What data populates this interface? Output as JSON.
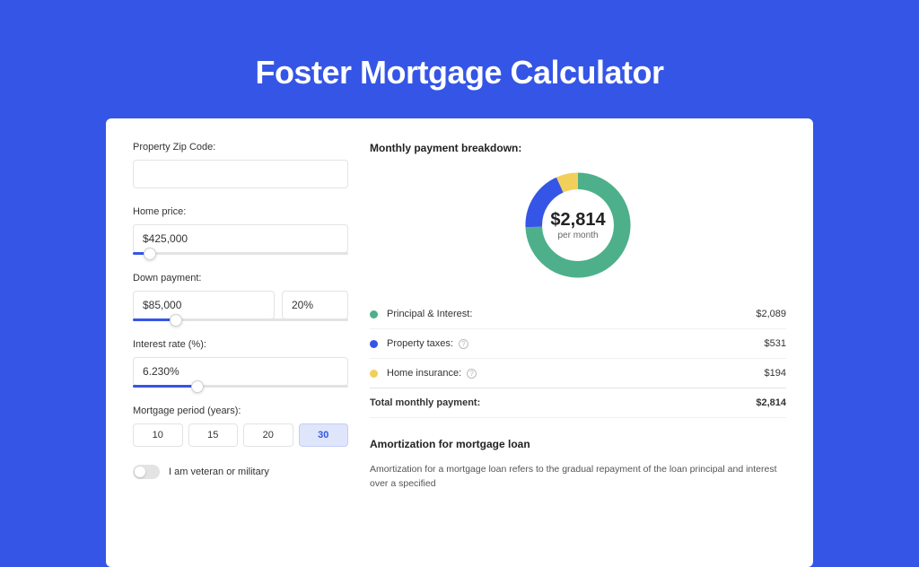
{
  "title": "Foster Mortgage Calculator",
  "form": {
    "zip_label": "Property Zip Code:",
    "zip_value": "",
    "home_price_label": "Home price:",
    "home_price_value": "$425,000",
    "home_price_slider_pct": 8,
    "down_payment_label": "Down payment:",
    "down_payment_value": "$85,000",
    "down_payment_pct_value": "20%",
    "down_payment_slider_pct": 20,
    "interest_label": "Interest rate (%):",
    "interest_value": "6.230%",
    "interest_slider_pct": 30,
    "period_label": "Mortgage period (years):",
    "periods": [
      "10",
      "15",
      "20",
      "30"
    ],
    "period_selected": "30",
    "veteran_label": "I am veteran or military"
  },
  "breakdown": {
    "heading": "Monthly payment breakdown:",
    "total_amount": "$2,814",
    "total_sub": "per month",
    "items": [
      {
        "label": "Principal & Interest:",
        "value": "$2,089",
        "color": "#4db08a",
        "has_info": false
      },
      {
        "label": "Property taxes:",
        "value": "$531",
        "color": "#3555e6",
        "has_info": true
      },
      {
        "label": "Home insurance:",
        "value": "$194",
        "color": "#f2cf5b",
        "has_info": true
      }
    ],
    "total_row_label": "Total monthly payment:",
    "total_row_value": "$2,814"
  },
  "chart_data": {
    "type": "pie",
    "title": "Monthly payment breakdown",
    "series": [
      {
        "name": "Principal & Interest",
        "value": 2089,
        "color": "#4db08a"
      },
      {
        "name": "Property taxes",
        "value": 531,
        "color": "#3555e6"
      },
      {
        "name": "Home insurance",
        "value": 194,
        "color": "#f2cf5b"
      }
    ],
    "total": 2814,
    "center_label": "$2,814",
    "center_sub": "per month"
  },
  "amortization": {
    "heading": "Amortization for mortgage loan",
    "text": "Amortization for a mortgage loan refers to the gradual repayment of the loan principal and interest over a specified"
  },
  "colors": {
    "accent": "#3555e6",
    "green": "#4db08a",
    "yellow": "#f2cf5b"
  }
}
